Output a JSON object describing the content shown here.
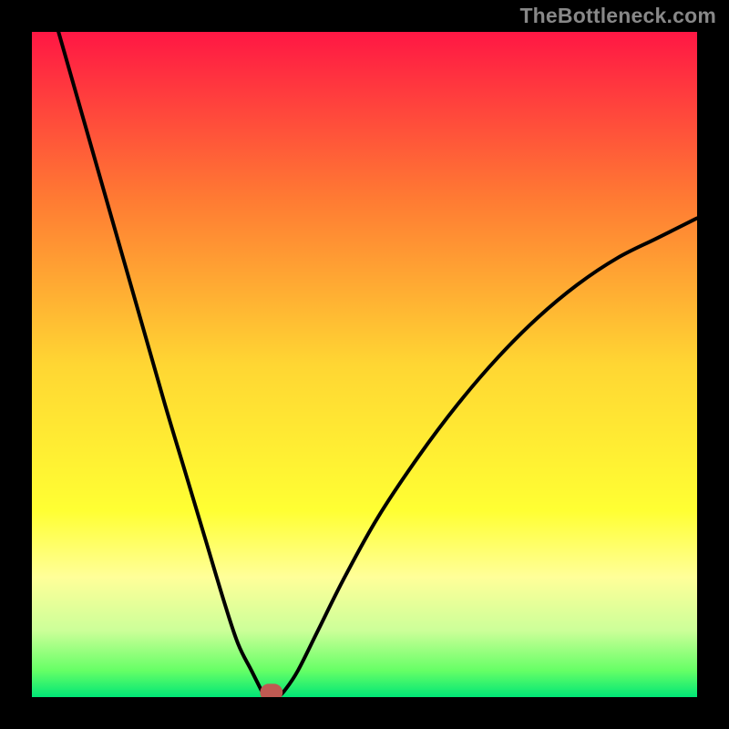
{
  "watermark": "TheBottleneck.com",
  "chart_data": {
    "type": "line",
    "title": "",
    "xlabel": "",
    "ylabel": "",
    "xlim": [
      0,
      100
    ],
    "ylim": [
      0,
      100
    ],
    "grid": false,
    "background": "rainbow_gradient_red_to_green",
    "gradient_stops": [
      {
        "offset": 0.0,
        "color": "#ff1744"
      },
      {
        "offset": 0.25,
        "color": "#ff7a33"
      },
      {
        "offset": 0.5,
        "color": "#ffd633"
      },
      {
        "offset": 0.72,
        "color": "#ffff33"
      },
      {
        "offset": 0.82,
        "color": "#ffff99"
      },
      {
        "offset": 0.9,
        "color": "#ccff99"
      },
      {
        "offset": 0.96,
        "color": "#66ff66"
      },
      {
        "offset": 1.0,
        "color": "#00e676"
      }
    ],
    "series": [
      {
        "name": "left-branch",
        "x": [
          4,
          8,
          12,
          16,
          20,
          23,
          26,
          29,
          31,
          33,
          34.5,
          35
        ],
        "y": [
          100,
          86,
          72,
          58,
          44,
          34,
          24,
          14,
          8,
          4,
          1,
          0
        ]
      },
      {
        "name": "right-branch",
        "x": [
          37,
          38,
          40,
          43,
          47,
          52,
          58,
          64,
          70,
          76,
          82,
          88,
          94,
          100
        ],
        "y": [
          0,
          1,
          4,
          10,
          18,
          27,
          36,
          44,
          51,
          57,
          62,
          66,
          69,
          72
        ]
      }
    ],
    "marker": {
      "x": 36,
      "y": 0.7,
      "color": "#bf5a52",
      "shape": "rounded-rect"
    }
  }
}
